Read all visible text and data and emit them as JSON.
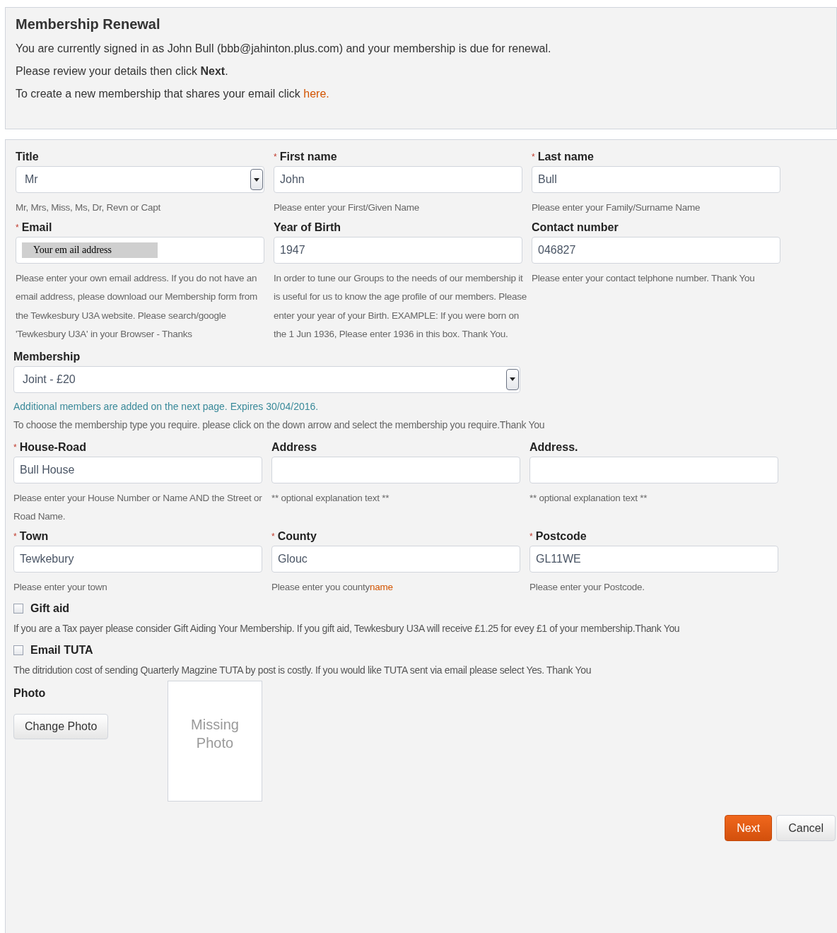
{
  "header": {
    "title": "Membership Renewal",
    "paragraphs": [
      "You are currently signed in as John Bull (bbb@jahinton.plus.com) and your membership is due for renewal.",
      "Please review your details then click **Next**."
    ],
    "link_paragraph": {
      "text": "To create a new membership that shares your email click",
      "link": "here."
    }
  },
  "rows": [
    {
      "fields": [
        {
          "label": "Title",
          "kind": "select",
          "value": "Mr",
          "help": "Mr, Mrs, Miss, Ms, Dr, Revn or Capt"
        },
        {
          "label": "First name",
          "required_mark": "*",
          "kind": "text",
          "value": "John",
          "help": "Please enter your First/Given Name"
        },
        {
          "label": "Last name",
          "required_mark": "*",
          "kind": "text",
          "value": "Bull",
          "help": "Please enter your Family/Surname Name"
        }
      ]
    },
    {
      "fields": [
        {
          "label": "Email",
          "required_mark": "*",
          "kind": "masked",
          "value": "Your em ail address",
          "help": "Please enter your own email address. If you do not have an email address, please download our Membership form from the Tewkesbury U3A website. Please search/google 'Tewkesbury U3A' in your Browser - Thanks"
        },
        {
          "label": "Year of Birth",
          "kind": "text",
          "value": "1947",
          "help": "In order to tune our Groups to the needs of our membership it is useful for us to know the age profile of our members. Please enter your year of your Birth. EXAMPLE: If you were born on the 1 Jun 1936, Please enter 1936 in this box. Thank You."
        },
        {
          "label": "Contact number",
          "kind": "text",
          "value": "046827",
          "help": "Please enter your contact telphone number. Thank You"
        }
      ]
    }
  ],
  "membership": {
    "label": "Membership",
    "value": "Joint - £20",
    "note": "Additional members are added on the next page. Expires 30/04/2016.",
    "help": "To choose the membership type you require. please click on the down arrow and select the membership you require.Thank You"
  },
  "address_rows": [
    {
      "fields": [
        {
          "label": "House-Road",
          "required_mark": "*",
          "kind": "text",
          "value": "Bull House",
          "help": "Please enter your House Number or Name AND the Street or Road Name."
        },
        {
          "label": "Address",
          "kind": "text",
          "help": "** optional explanation text **"
        },
        {
          "label": "Address.",
          "kind": "text",
          "help": "** optional explanation text **"
        }
      ]
    },
    {
      "fields": [
        {
          "label": "Town",
          "required_mark": "*",
          "kind": "text",
          "value": "Tewkebury",
          "help": "Please enter your town"
        },
        {
          "label": "County",
          "required_mark": "*",
          "kind": "text",
          "value": "Glouc",
          "help": "Please enter you county",
          "help_accent": "name"
        },
        {
          "label": "Postcode",
          "required_mark": "*",
          "kind": "text",
          "value": "GL11WE",
          "help": "Please enter your Postcode."
        }
      ]
    }
  ],
  "options": [
    {
      "label": "Gift aid",
      "checked": false,
      "help": "If you are a Tax payer please consider Gift Aiding Your Membership. If you gift aid, Tewkesbury U3A will receive £1.25 for evey £1 of your membership.Thank You"
    },
    {
      "label": "Email TUTA",
      "checked": false,
      "help": "The ditridution cost of sending Quarterly Magzine TUTA by post is costly. If you would like TUTA sent via email please select Yes. Thank You"
    }
  ],
  "photo": {
    "label": "Photo",
    "button": "Change Photo",
    "placeholder": "Missing Photo"
  },
  "buttons": [
    {
      "label": "Next",
      "kind": "primary"
    },
    {
      "label": "Cancel",
      "kind": "secondary"
    }
  ]
}
